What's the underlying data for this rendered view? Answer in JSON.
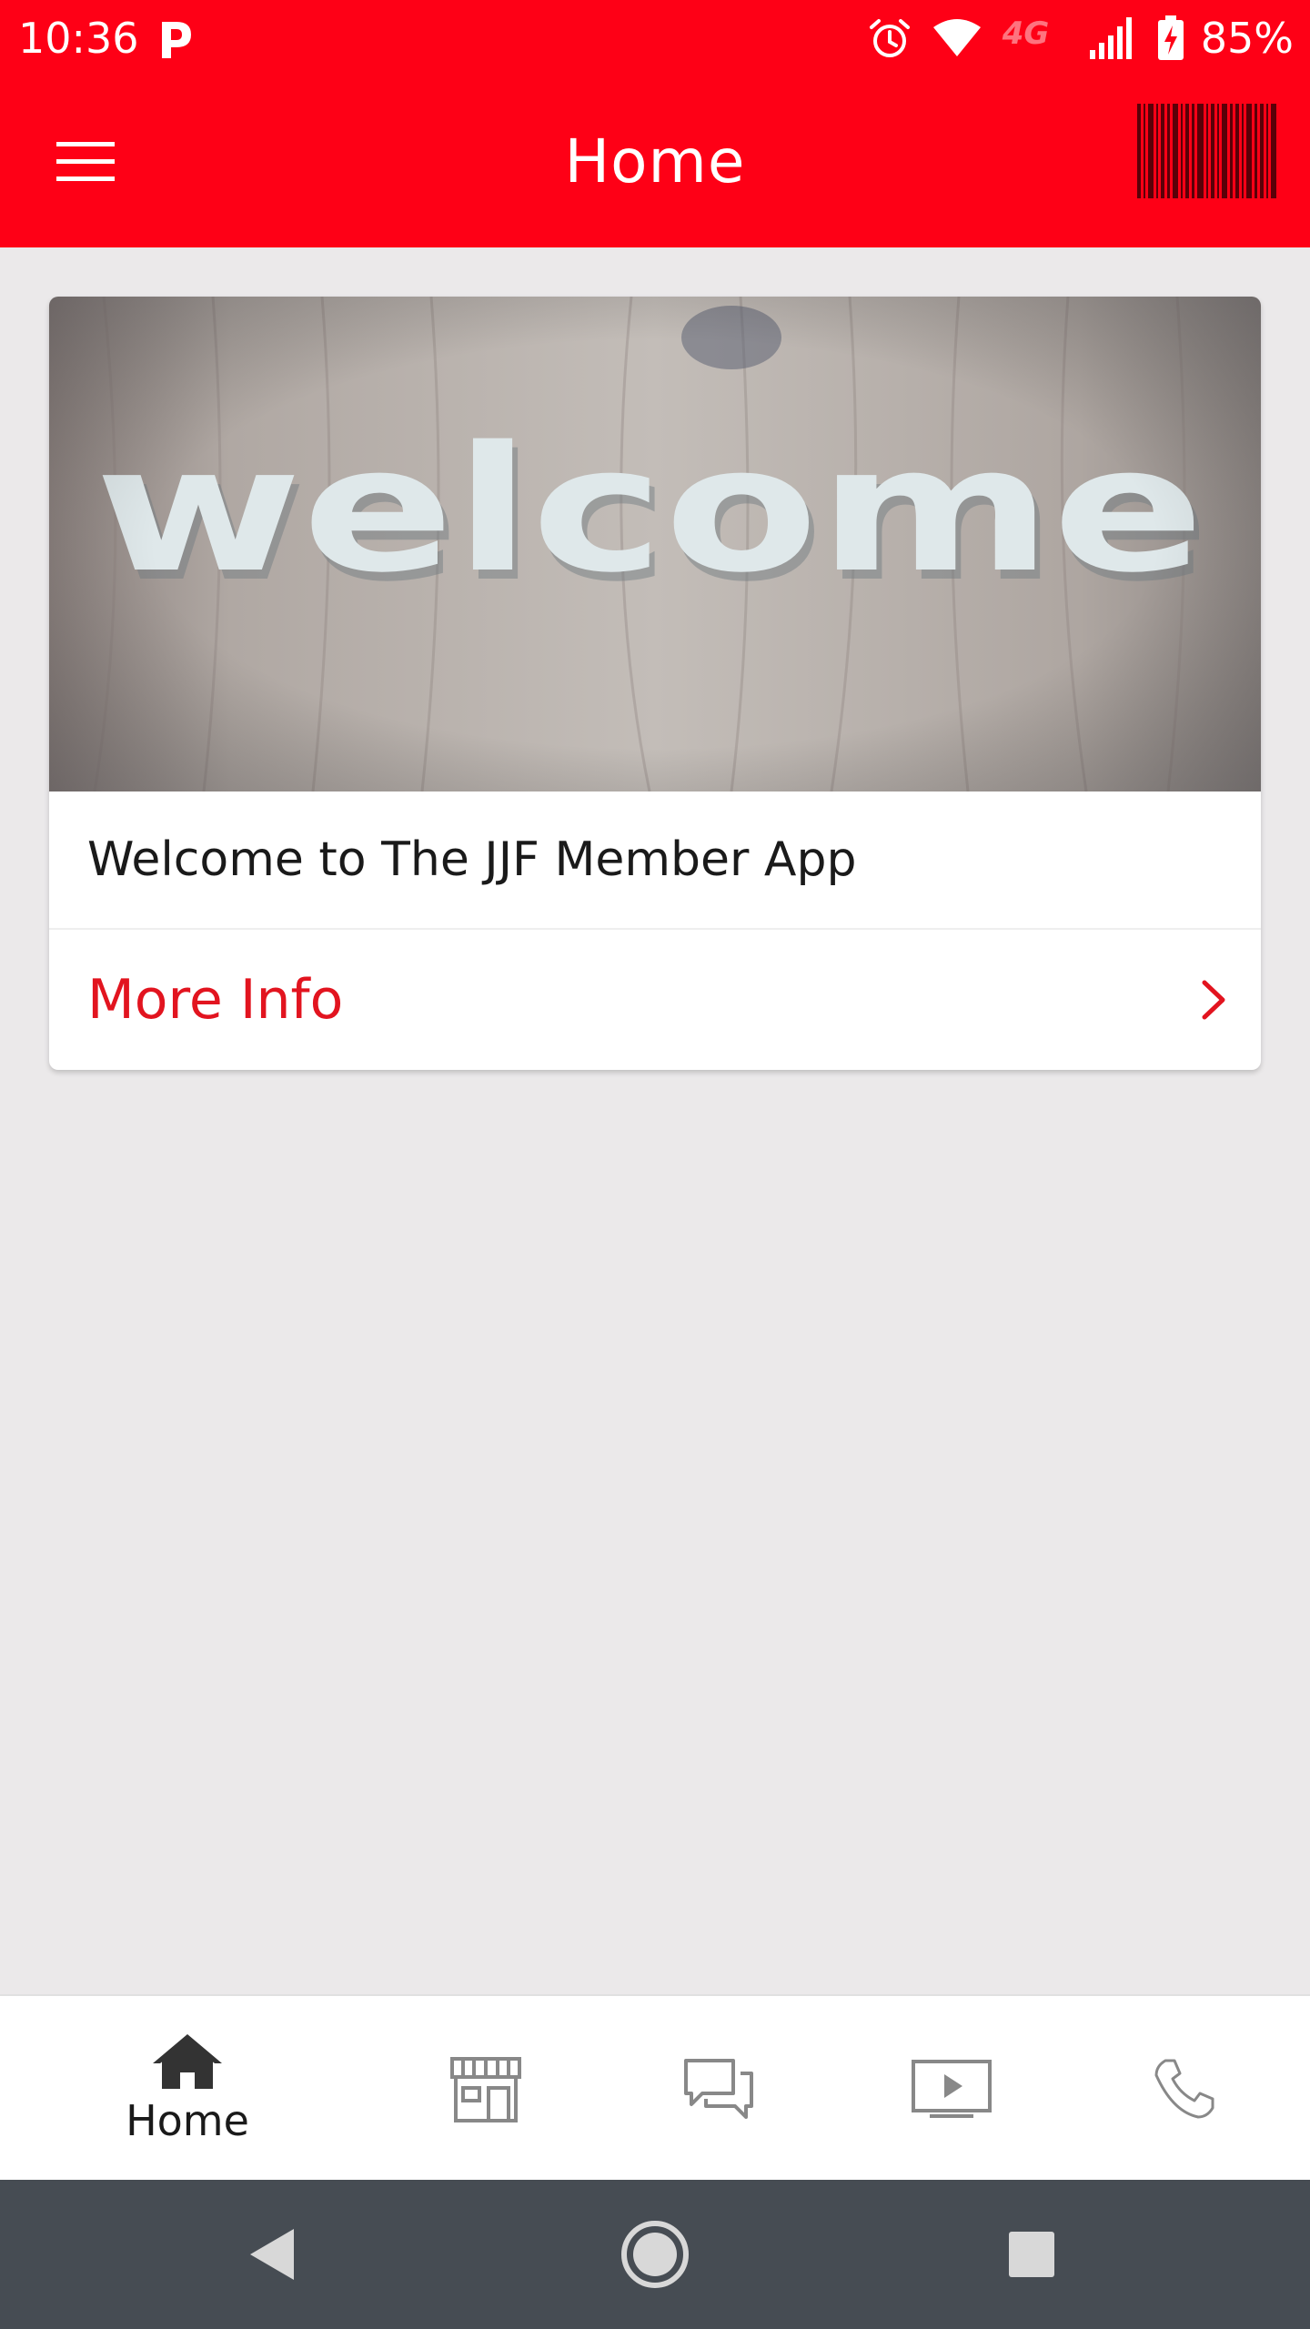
{
  "status_bar": {
    "time": "10:36",
    "battery_percent": "85%",
    "network_label": "4G",
    "icons": [
      "parking-p-icon",
      "alarm-icon",
      "wifi-icon",
      "network-4g-icon",
      "signal-icon",
      "battery-charging-icon"
    ]
  },
  "app_bar": {
    "title": "Home",
    "menu_icon": "hamburger-menu-icon",
    "barcode_icon": "barcode-icon",
    "background_color": "#fe0016"
  },
  "card": {
    "image_text": "welcome",
    "title": "Welcome to The JJF Member App",
    "link_label": "More Info",
    "link_color": "#e2141f"
  },
  "bottom_nav": {
    "items": [
      {
        "icon": "home-icon",
        "label": "Home",
        "active": true
      },
      {
        "icon": "store-icon",
        "label": ""
      },
      {
        "icon": "chat-bubbles-icon",
        "label": ""
      },
      {
        "icon": "video-play-icon",
        "label": ""
      },
      {
        "icon": "phone-icon",
        "label": ""
      }
    ]
  },
  "system_nav": {
    "buttons": [
      "back-icon",
      "home-circle-icon",
      "recents-square-icon"
    ]
  }
}
